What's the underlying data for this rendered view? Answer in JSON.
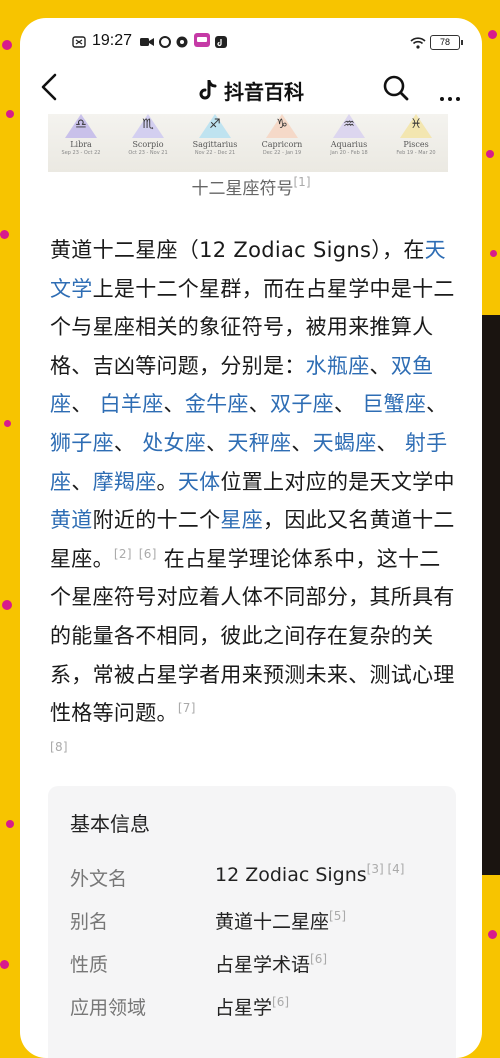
{
  "status_bar": {
    "time": "19:27",
    "battery": "78"
  },
  "nav": {
    "title": "抖音百科"
  },
  "zodiac_strip": [
    {
      "symbol": "♎",
      "name": "Libra",
      "dates": "Sep 23 - Oct 22"
    },
    {
      "symbol": "♏",
      "name": "Scorpio",
      "dates": "Oct 23 - Nov 21"
    },
    {
      "symbol": "♐",
      "name": "Sagittarius",
      "dates": "Nov 22 - Dec 21"
    },
    {
      "symbol": "♑",
      "name": "Capricorn",
      "dates": "Dec 22 - Jan 19"
    },
    {
      "symbol": "♒",
      "name": "Aquarius",
      "dates": "Jan 20 - Feb 18"
    },
    {
      "symbol": "♓",
      "name": "Pisces",
      "dates": "Feb 19 - Mar 20"
    }
  ],
  "caption": {
    "text": "十二星座符号",
    "ref": "[1]"
  },
  "paragraph": {
    "s1": "黄道十二星座（12 Zodiac Signs），在",
    "link_astronomy": "天文学",
    "s2": "上是十二个星群，而在占星学中是十二个与星座相关的象征符号，被用来推算人格、吉凶等问题，分别是：",
    "signs": [
      "水瓶座",
      "双鱼座",
      "白羊座",
      "金牛座",
      "双子座",
      "巨蟹座",
      "狮子座",
      "处女座",
      "天秤座",
      "天蝎座",
      "射手座",
      "摩羯座"
    ],
    "sep": "、",
    "end_dot": "。",
    "link_celestial": "天体",
    "s3": "位置上对应的是天文学中",
    "link_ecliptic": "黄道",
    "s4": "附近的十二个",
    "link_constellation": "星座",
    "s5": "，因此又名黄道十二星座。",
    "ref2": "[2]",
    "ref6": "[6]",
    "s6": "在占星学理论体系中，这十二个星座符号对应着人体不同部分，其所具有的能量各不相同，彼此之间存在复杂的关系，常被占星学者用来预测未来、测试心理性格等问题。",
    "ref7": "[7]",
    "ref8": "[8]"
  },
  "info": {
    "heading": "基本信息",
    "rows": [
      {
        "key": "外文名",
        "value": "12 Zodiac Signs",
        "refs": "[3] [4]"
      },
      {
        "key": "别名",
        "value": "黄道十二星座",
        "refs": "[5]"
      },
      {
        "key": "性质",
        "value": "占星学术语",
        "refs": "[6]"
      },
      {
        "key": "应用领域",
        "value": "占星学",
        "refs": "[6]"
      }
    ]
  }
}
